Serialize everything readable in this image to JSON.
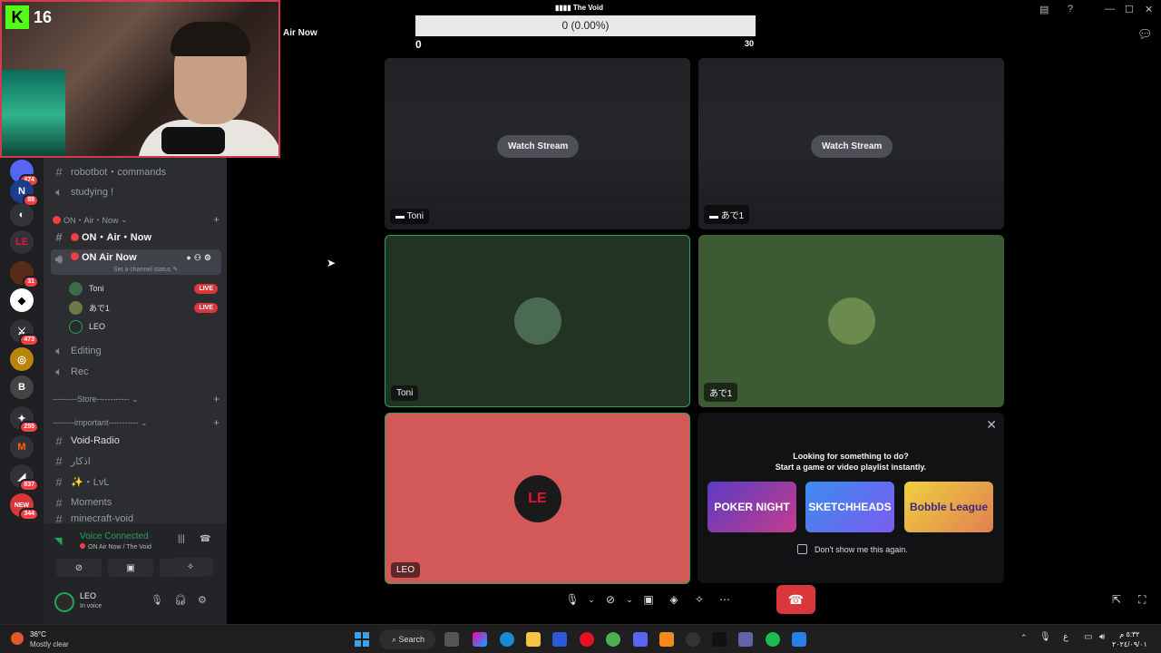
{
  "overlay": {
    "follower_count": "16"
  },
  "progress": {
    "title": "The Void",
    "text": "0 (0.00%)",
    "min": "0",
    "max": "30"
  },
  "window": {
    "title": "Air Now"
  },
  "rail": {
    "badges": [
      "474",
      "88",
      "31",
      "473",
      "255",
      "837",
      "NEW",
      "344"
    ]
  },
  "channels": {
    "robotbot": "robotbot・commands",
    "studying": "studying !",
    "category_on_air": "ON・Air・Now",
    "text_on_air": "ON・Air・Now",
    "voice_on_air": "ON Air Now",
    "set_status": "Set a channel status",
    "users": [
      {
        "name": "Toni",
        "badge": "LIVE"
      },
      {
        "name": "あで1",
        "badge": "LIVE"
      },
      {
        "name": "LEO",
        "badge": ""
      }
    ],
    "editing": "Editing",
    "rec": "Rec",
    "category_store": "---------Store------------",
    "category_important": "--------important-----------",
    "void_radio": "Void-Radio",
    "athkar": "اذكار",
    "lvl": "✨・LvL",
    "moments": "Moments",
    "minecraft": "minecraft-void"
  },
  "voice_panel": {
    "status": "Voice Connected",
    "location": "ON Air Now / The Void"
  },
  "user_panel": {
    "name": "LEO",
    "status": "In voice"
  },
  "streams": [
    {
      "name": "Toni",
      "action": "Watch Stream"
    },
    {
      "name": "あで1",
      "action": "Watch Stream"
    }
  ],
  "cams": [
    {
      "name": "Toni"
    },
    {
      "name": "あで1"
    },
    {
      "name": "LEO"
    }
  ],
  "activity": {
    "line1": "Looking for something to do?",
    "line2": "Start a game or video playlist instantly.",
    "games": [
      "POKER NIGHT",
      "SKETCHHEADS",
      "Bobble League"
    ],
    "checkbox_label": "Don't show me this again."
  },
  "taskbar": {
    "weather_temp": "36°C",
    "weather_desc": "Mostly clear",
    "search": "Search",
    "clock_time": "٥:٣٢ م",
    "clock_date": "٢٠٢٤/٠٩/٠١",
    "lang": "ع"
  },
  "colors": {
    "accent_red": "#da373c",
    "live_green": "#23a55a",
    "tile_green_1": "#223324",
    "tile_green_2": "#3c5a33",
    "tile_red": "#d35858"
  }
}
